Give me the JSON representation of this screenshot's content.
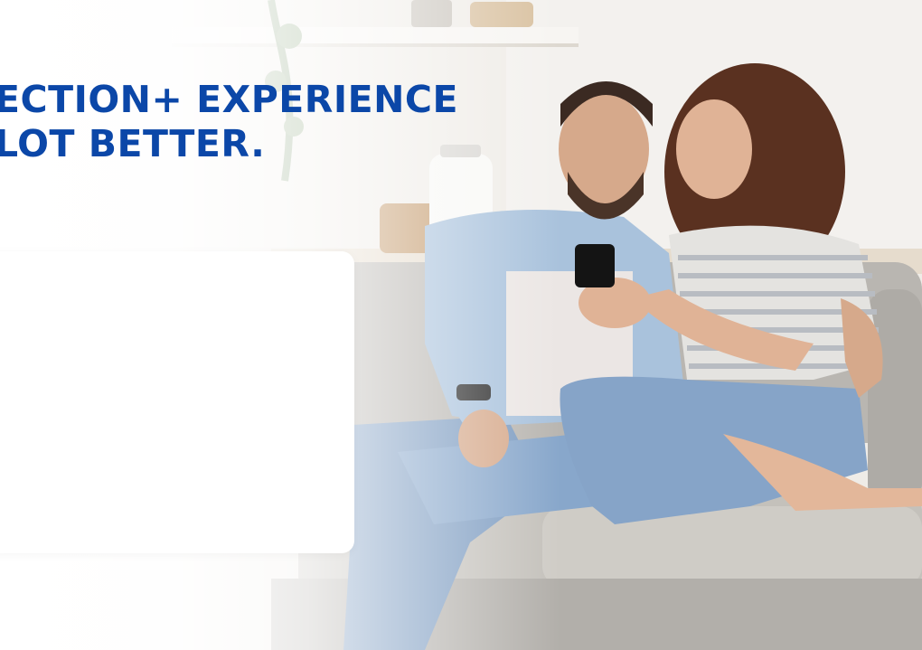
{
  "hero": {
    "headline_line1": "ECTION+ EXPERIENCE",
    "headline_line2": "LOT BETTER.",
    "headline_color": "#0b47a8",
    "image_description_icon": "couple-on-sofa-photo"
  },
  "card": {
    "background": "#ffffff"
  }
}
